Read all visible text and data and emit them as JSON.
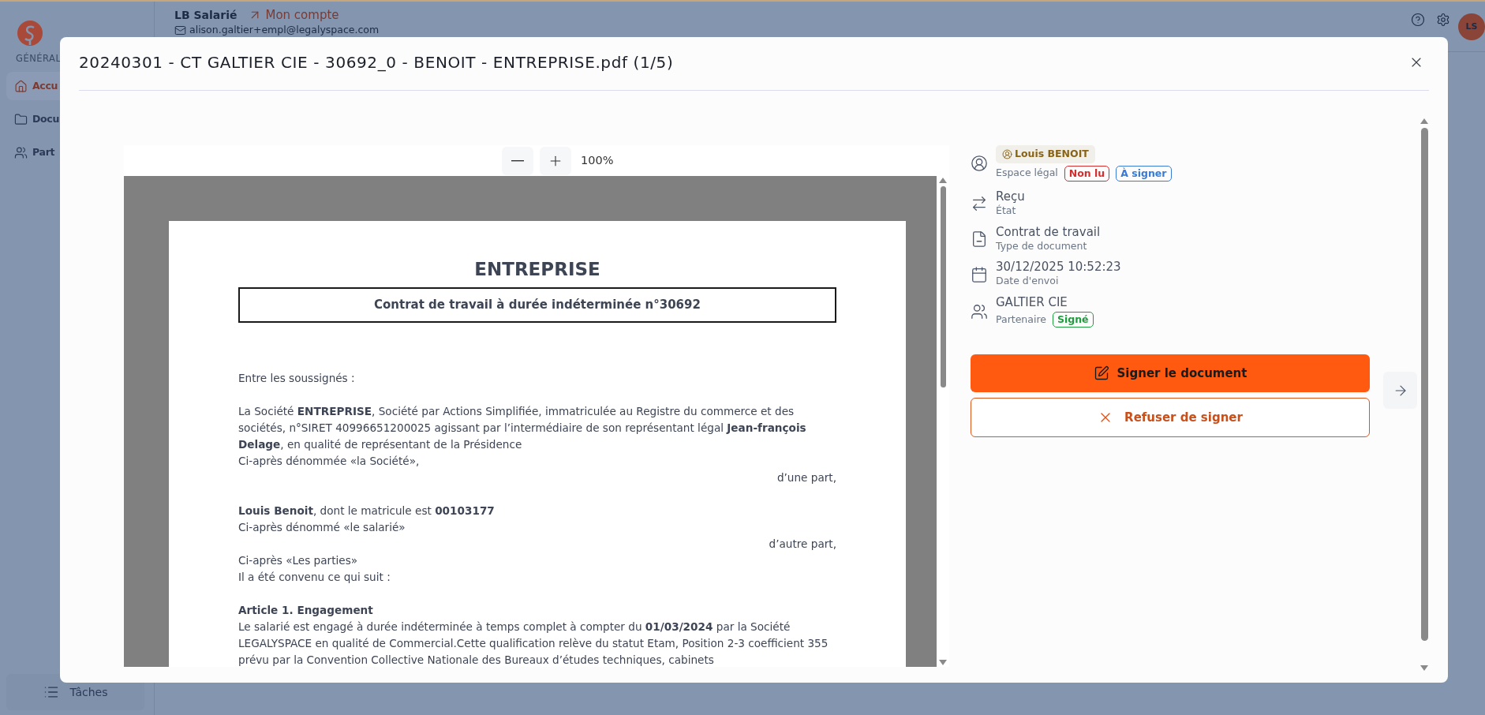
{
  "sidebar": {
    "section_label": "GÉNÉRAL",
    "nav": [
      {
        "label": "Accu",
        "selected": true
      },
      {
        "label": "Docu",
        "selected": false
      },
      {
        "label": "Part",
        "selected": false
      }
    ],
    "tasks_button": "Tâches"
  },
  "header": {
    "user": "LB Salarié",
    "account_link": "Mon compte",
    "email": "alison.galtier+empl@legalyspace.com",
    "avatar": "LS"
  },
  "modal": {
    "title": "20240301 - CT GALTIER CIE - 30692_0 - BENOIT - ENTREPRISE.pdf (1/5)",
    "viewer": {
      "zoom": "100%",
      "page": {
        "heading": "ENTREPRISE",
        "subtitle": "Contrat de travail à durée indéterminée n°30692",
        "paragraphs": [
          {
            "lines": [
              {
                "kind": "text",
                "text": "Entre les soussignés :"
              }
            ]
          },
          {
            "lines": [
              {
                "kind": "text",
                "text": "La Société **ENTREPRISE**, Société par Actions Simplifiée, immatriculée au Registre du commerce et des sociétés, n°SIRET 40996651200025 agissant par l’intermédiaire de son représentant légal **Jean-françois Delage**, en qualité de représentant de la Présidence"
              },
              {
                "kind": "text",
                "text": "Ci-après dénommée «la Société»,"
              },
              {
                "kind": "right",
                "text": "d’une part,"
              }
            ]
          },
          {
            "lines": [
              {
                "kind": "text",
                "text": "**Louis Benoit**, dont le matricule est **00103177**"
              },
              {
                "kind": "text",
                "text": "Ci-après dénommé «le salarié»"
              },
              {
                "kind": "right",
                "text": "d’autre part,"
              },
              {
                "kind": "text",
                "text": "Ci-après «Les parties»"
              },
              {
                "kind": "text",
                "text": "Il a été convenu ce qui suit :"
              }
            ]
          },
          {
            "lines": [
              {
                "kind": "heading",
                "text": "Article 1. Engagement"
              },
              {
                "kind": "text",
                "text": "Le salarié est engagé à durée indéterminée à temps complet à compter du **01/03/2024** par la Société LEGALYSPACE en qualité de Commercial.Cette qualification relève du statut Etam, Position 2-3 coefficient 355 prévu par la Convention Collective Nationale des Bureaux d’études techniques, cabinets"
              }
            ]
          }
        ]
      }
    },
    "details": [
      {
        "kind": "person",
        "chip": "Louis BENOIT",
        "label": "Espace légal",
        "badges": [
          {
            "label": "Non lu",
            "color": "#d32f2f"
          },
          {
            "label": "À signer",
            "color": "#3a7bd5"
          }
        ]
      },
      {
        "kind": "field",
        "value": "Reçu",
        "label": "État"
      },
      {
        "kind": "field",
        "value": "Contrat de travail",
        "label": "Type de document"
      },
      {
        "kind": "field",
        "value": "30/12/2025 10:52:23",
        "label": "Date d'envoi"
      },
      {
        "kind": "partner",
        "value": "GALTIER CIE",
        "label": "Partenaire",
        "badges": [
          {
            "label": "Signé",
            "color": "#1f9d3e"
          }
        ]
      }
    ],
    "sign_button": "Signer le document",
    "refuse_button": "Refuser de signer"
  }
}
